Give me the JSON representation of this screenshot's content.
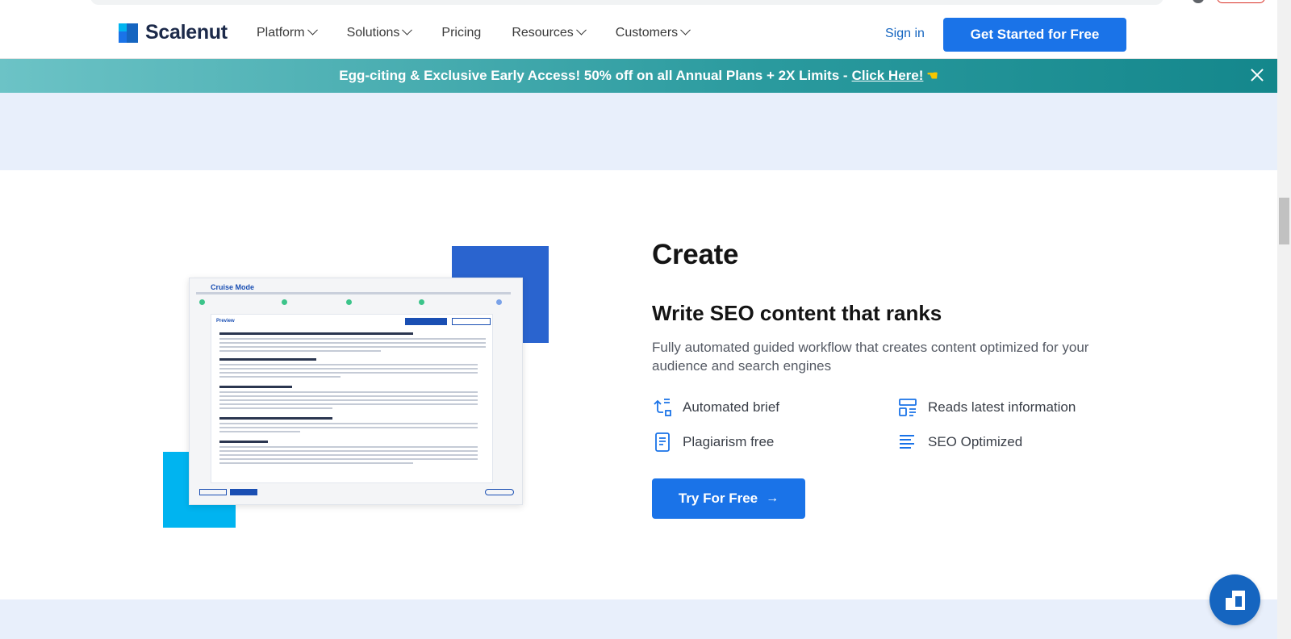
{
  "brand": {
    "name": "Scalenut"
  },
  "nav": {
    "items": [
      {
        "label": "Platform",
        "has_dropdown": true
      },
      {
        "label": "Solutions",
        "has_dropdown": true
      },
      {
        "label": "Pricing",
        "has_dropdown": false
      },
      {
        "label": "Resources",
        "has_dropdown": true
      },
      {
        "label": "Customers",
        "has_dropdown": true
      }
    ],
    "signin_label": "Sign in",
    "cta_label": "Get Started for Free"
  },
  "promo": {
    "text": "Egg-citing & Exclusive Early Access! 50% off on all Annual Plans + 2X Limits -",
    "link_label": "Click Here!",
    "icon": "pointing-hand-icon"
  },
  "illustration": {
    "title": "Cruise Mode",
    "preview_label": "Preview"
  },
  "section": {
    "title_start": "Cr",
    "title_highlight": "eate",
    "subheading": "Write SEO content that ranks",
    "description": "Fully automated guided workflow that creates content optimized for your audience and search engines",
    "features": [
      {
        "label": "Automated brief",
        "icon": "automation-icon"
      },
      {
        "label": "Reads latest information",
        "icon": "layout-icon"
      },
      {
        "label": "Plagiarism free",
        "icon": "document-icon"
      },
      {
        "label": "SEO Optimized",
        "icon": "text-lines-icon"
      }
    ],
    "cta_label": "Try For Free"
  },
  "colors": {
    "primary": "#1a73e8",
    "brand_dark": "#1565c0",
    "promo_teal": "#2a9a9e",
    "highlight": "#f5d64e",
    "band": "#e8effb"
  }
}
